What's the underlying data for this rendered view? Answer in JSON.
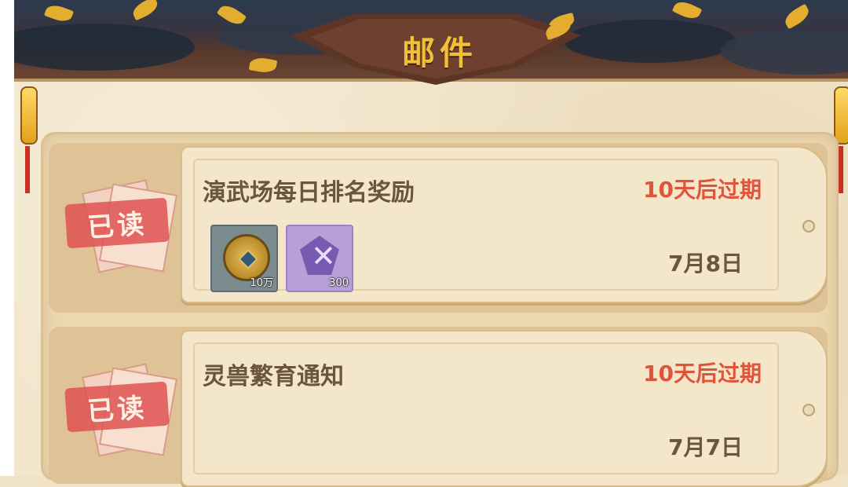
{
  "header": {
    "title": "邮件"
  },
  "mails": [
    {
      "status": "已读",
      "title": "演武场每日排名奖励",
      "expire": "10天后过期",
      "date": "7月8日",
      "items": [
        {
          "icon": "copper-coin-icon",
          "qty": "10万"
        },
        {
          "icon": "purple-crystal-icon",
          "qty": "300"
        }
      ]
    },
    {
      "status": "已读",
      "title": "灵兽繁育通知",
      "expire": "10天后过期",
      "date": "7月7日",
      "items": []
    }
  ],
  "colors": {
    "expire": "#e0543b",
    "title": "#6b5440",
    "header_gold": "#f2bf3a"
  }
}
